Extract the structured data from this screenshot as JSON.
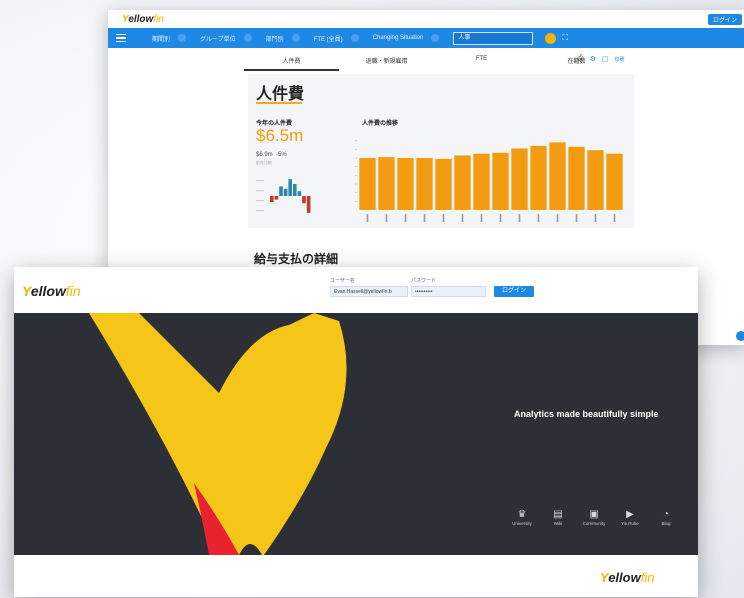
{
  "back": {
    "logo": {
      "y": "Y",
      "ellow": "ellow",
      "fin": "fin"
    },
    "login_btn": "ログイン",
    "nav": {
      "filters": [
        "期間別",
        "グループ単位",
        "部門別",
        "FTE (全員)",
        "Changing Situation"
      ],
      "search": "人事",
      "expand": "⛶"
    },
    "tabs": [
      "人件費",
      "退職・新規雇用",
      "FTE",
      "在籍数"
    ],
    "active_tab": 0,
    "tools_label": "印刷",
    "panel": {
      "title": "人件費",
      "kpi_label": "今年の人件費",
      "kpi_value": "$6.5m",
      "kpi_small": "$6.9m",
      "kpi_pct": "-5%",
      "kpi_sub": "前年比較",
      "chart_title": "人件費の推移"
    },
    "section_title": "給与支払の詳細"
  },
  "chart_data": [
    {
      "type": "bar",
      "title": "人件費の推移",
      "categories": [
        "1",
        "2",
        "3",
        "4",
        "5",
        "6",
        "7",
        "8",
        "9",
        "10",
        "11",
        "12",
        "13",
        "14"
      ],
      "values": [
        6.0,
        6.1,
        6.0,
        6.0,
        5.9,
        6.3,
        6.5,
        6.6,
        7.1,
        7.4,
        7.8,
        7.3,
        6.9,
        6.5
      ],
      "ylim": [
        0,
        9
      ],
      "color": "#f39c12"
    },
    {
      "type": "bar",
      "title": "",
      "categories": [
        "1",
        "2",
        "3",
        "4",
        "5",
        "6",
        "7",
        "8",
        "9"
      ],
      "values": [
        -0.5,
        -0.3,
        0.8,
        0.6,
        1.4,
        1.0,
        0.4,
        -0.6,
        -1.4
      ],
      "colors": [
        "#c0392b",
        "#c0392b",
        "#2e86ab",
        "#2e86ab",
        "#2e86ab",
        "#2e86ab",
        "#2e86ab",
        "#c0392b",
        "#c0392b"
      ]
    }
  ],
  "front": {
    "logo": {
      "y": "Y",
      "ellow": "ellow",
      "fin": "fin"
    },
    "username_label": "ユーザー名",
    "username_value": "Evan.Hassell@yellowfin.b",
    "password_label": "パスワード",
    "password_value": "••••••••••",
    "login_btn": "ログイン",
    "tagline": "Analytics made beautifully simple",
    "links": [
      {
        "label": "University",
        "icon": "university-icon",
        "glyph": "♛"
      },
      {
        "label": "Wiki",
        "icon": "wiki-icon",
        "glyph": "▤"
      },
      {
        "label": "Community",
        "icon": "community-icon",
        "glyph": "▣"
      },
      {
        "label": "YouTube",
        "icon": "youtube-icon",
        "glyph": "▶"
      },
      {
        "label": "Blog",
        "icon": "blog-icon",
        "glyph": "◔"
      }
    ],
    "footer_logo": {
      "y": "Y",
      "ellow": "ellow",
      "fin": "fin"
    },
    "colors": {
      "accent": "#1e88e5",
      "brand_yellow": "#f5c518",
      "brand_red": "#e8222e",
      "hero_bg": "#2c2f36"
    }
  }
}
